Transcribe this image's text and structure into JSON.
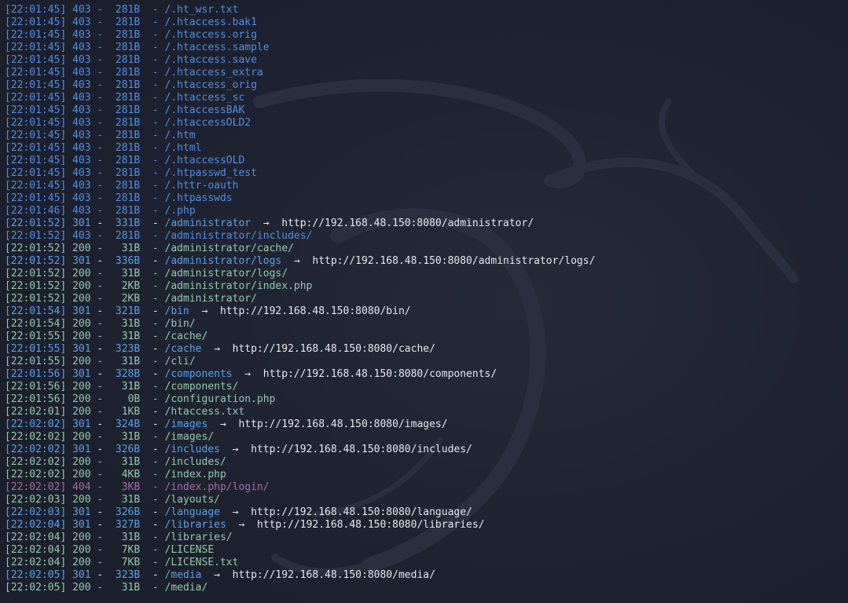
{
  "colors": {
    "background": "#1e2230",
    "status_403": "#4f8ee6",
    "status_301": "#5aa0e8",
    "status_200": "#93c9ae",
    "status_404": "#a86aa8",
    "redirect_text": "#e6e8ea"
  },
  "icons": {
    "background_logo": "kali-dragon-icon",
    "redirect_arrow": "right-arrow-icon"
  },
  "lines": [
    {
      "ts": "[22:01:45]",
      "code": "403",
      "size": "281B",
      "path": "/.ht_wsr.txt",
      "target": ""
    },
    {
      "ts": "[22:01:45]",
      "code": "403",
      "size": "281B",
      "path": "/.htaccess.bak1",
      "target": ""
    },
    {
      "ts": "[22:01:45]",
      "code": "403",
      "size": "281B",
      "path": "/.htaccess.orig",
      "target": ""
    },
    {
      "ts": "[22:01:45]",
      "code": "403",
      "size": "281B",
      "path": "/.htaccess.sample",
      "target": ""
    },
    {
      "ts": "[22:01:45]",
      "code": "403",
      "size": "281B",
      "path": "/.htaccess.save",
      "target": ""
    },
    {
      "ts": "[22:01:45]",
      "code": "403",
      "size": "281B",
      "path": "/.htaccess_extra",
      "target": ""
    },
    {
      "ts": "[22:01:45]",
      "code": "403",
      "size": "281B",
      "path": "/.htaccess_orig",
      "target": ""
    },
    {
      "ts": "[22:01:45]",
      "code": "403",
      "size": "281B",
      "path": "/.htaccess_sc",
      "target": ""
    },
    {
      "ts": "[22:01:45]",
      "code": "403",
      "size": "281B",
      "path": "/.htaccessBAK",
      "target": ""
    },
    {
      "ts": "[22:01:45]",
      "code": "403",
      "size": "281B",
      "path": "/.htaccessOLD2",
      "target": ""
    },
    {
      "ts": "[22:01:45]",
      "code": "403",
      "size": "281B",
      "path": "/.htm",
      "target": ""
    },
    {
      "ts": "[22:01:45]",
      "code": "403",
      "size": "281B",
      "path": "/.html",
      "target": ""
    },
    {
      "ts": "[22:01:45]",
      "code": "403",
      "size": "281B",
      "path": "/.htaccessOLD",
      "target": ""
    },
    {
      "ts": "[22:01:45]",
      "code": "403",
      "size": "281B",
      "path": "/.htpasswd_test",
      "target": ""
    },
    {
      "ts": "[22:01:45]",
      "code": "403",
      "size": "281B",
      "path": "/.httr-oauth",
      "target": ""
    },
    {
      "ts": "[22:01:45]",
      "code": "403",
      "size": "281B",
      "path": "/.htpasswds",
      "target": ""
    },
    {
      "ts": "[22:01:46]",
      "code": "403",
      "size": "281B",
      "path": "/.php",
      "target": ""
    },
    {
      "ts": "[22:01:52]",
      "code": "301",
      "size": "331B",
      "path": "/administrator",
      "target": "http://192.168.48.150:8080/administrator/"
    },
    {
      "ts": "[22:01:52]",
      "code": "403",
      "size": "281B",
      "path": "/administrator/includes/",
      "target": ""
    },
    {
      "ts": "[22:01:52]",
      "code": "200",
      "size": "31B",
      "path": "/administrator/cache/",
      "target": ""
    },
    {
      "ts": "[22:01:52]",
      "code": "301",
      "size": "336B",
      "path": "/administrator/logs",
      "target": "http://192.168.48.150:8080/administrator/logs/"
    },
    {
      "ts": "[22:01:52]",
      "code": "200",
      "size": "31B",
      "path": "/administrator/logs/",
      "target": ""
    },
    {
      "ts": "[22:01:52]",
      "code": "200",
      "size": "2KB",
      "path": "/administrator/index.php",
      "target": ""
    },
    {
      "ts": "[22:01:52]",
      "code": "200",
      "size": "2KB",
      "path": "/administrator/",
      "target": ""
    },
    {
      "ts": "[22:01:54]",
      "code": "301",
      "size": "321B",
      "path": "/bin",
      "target": "http://192.168.48.150:8080/bin/"
    },
    {
      "ts": "[22:01:54]",
      "code": "200",
      "size": "31B",
      "path": "/bin/",
      "target": ""
    },
    {
      "ts": "[22:01:55]",
      "code": "200",
      "size": "31B",
      "path": "/cache/",
      "target": ""
    },
    {
      "ts": "[22:01:55]",
      "code": "301",
      "size": "323B",
      "path": "/cache",
      "target": "http://192.168.48.150:8080/cache/"
    },
    {
      "ts": "[22:01:55]",
      "code": "200",
      "size": "31B",
      "path": "/cli/",
      "target": ""
    },
    {
      "ts": "[22:01:56]",
      "code": "301",
      "size": "328B",
      "path": "/components",
      "target": "http://192.168.48.150:8080/components/"
    },
    {
      "ts": "[22:01:56]",
      "code": "200",
      "size": "31B",
      "path": "/components/",
      "target": ""
    },
    {
      "ts": "[22:01:56]",
      "code": "200",
      "size": "0B",
      "path": "/configuration.php",
      "target": ""
    },
    {
      "ts": "[22:02:01]",
      "code": "200",
      "size": "1KB",
      "path": "/htaccess.txt",
      "target": ""
    },
    {
      "ts": "[22:02:02]",
      "code": "301",
      "size": "324B",
      "path": "/images",
      "target": "http://192.168.48.150:8080/images/"
    },
    {
      "ts": "[22:02:02]",
      "code": "200",
      "size": "31B",
      "path": "/images/",
      "target": ""
    },
    {
      "ts": "[22:02:02]",
      "code": "301",
      "size": "326B",
      "path": "/includes",
      "target": "http://192.168.48.150:8080/includes/"
    },
    {
      "ts": "[22:02:02]",
      "code": "200",
      "size": "31B",
      "path": "/includes/",
      "target": ""
    },
    {
      "ts": "[22:02:02]",
      "code": "200",
      "size": "4KB",
      "path": "/index.php",
      "target": ""
    },
    {
      "ts": "[22:02:02]",
      "code": "404",
      "size": "3KB",
      "path": "/index.php/login/",
      "target": ""
    },
    {
      "ts": "[22:02:03]",
      "code": "200",
      "size": "31B",
      "path": "/layouts/",
      "target": ""
    },
    {
      "ts": "[22:02:03]",
      "code": "301",
      "size": "326B",
      "path": "/language",
      "target": "http://192.168.48.150:8080/language/"
    },
    {
      "ts": "[22:02:04]",
      "code": "301",
      "size": "327B",
      "path": "/libraries",
      "target": "http://192.168.48.150:8080/libraries/"
    },
    {
      "ts": "[22:02:04]",
      "code": "200",
      "size": "31B",
      "path": "/libraries/",
      "target": ""
    },
    {
      "ts": "[22:02:04]",
      "code": "200",
      "size": "7KB",
      "path": "/LICENSE",
      "target": ""
    },
    {
      "ts": "[22:02:04]",
      "code": "200",
      "size": "7KB",
      "path": "/LICENSE.txt",
      "target": ""
    },
    {
      "ts": "[22:02:05]",
      "code": "301",
      "size": "323B",
      "path": "/media",
      "target": "http://192.168.48.150:8080/media/"
    },
    {
      "ts": "[22:02:05]",
      "code": "200",
      "size": "31B",
      "path": "/media/",
      "target": ""
    }
  ]
}
